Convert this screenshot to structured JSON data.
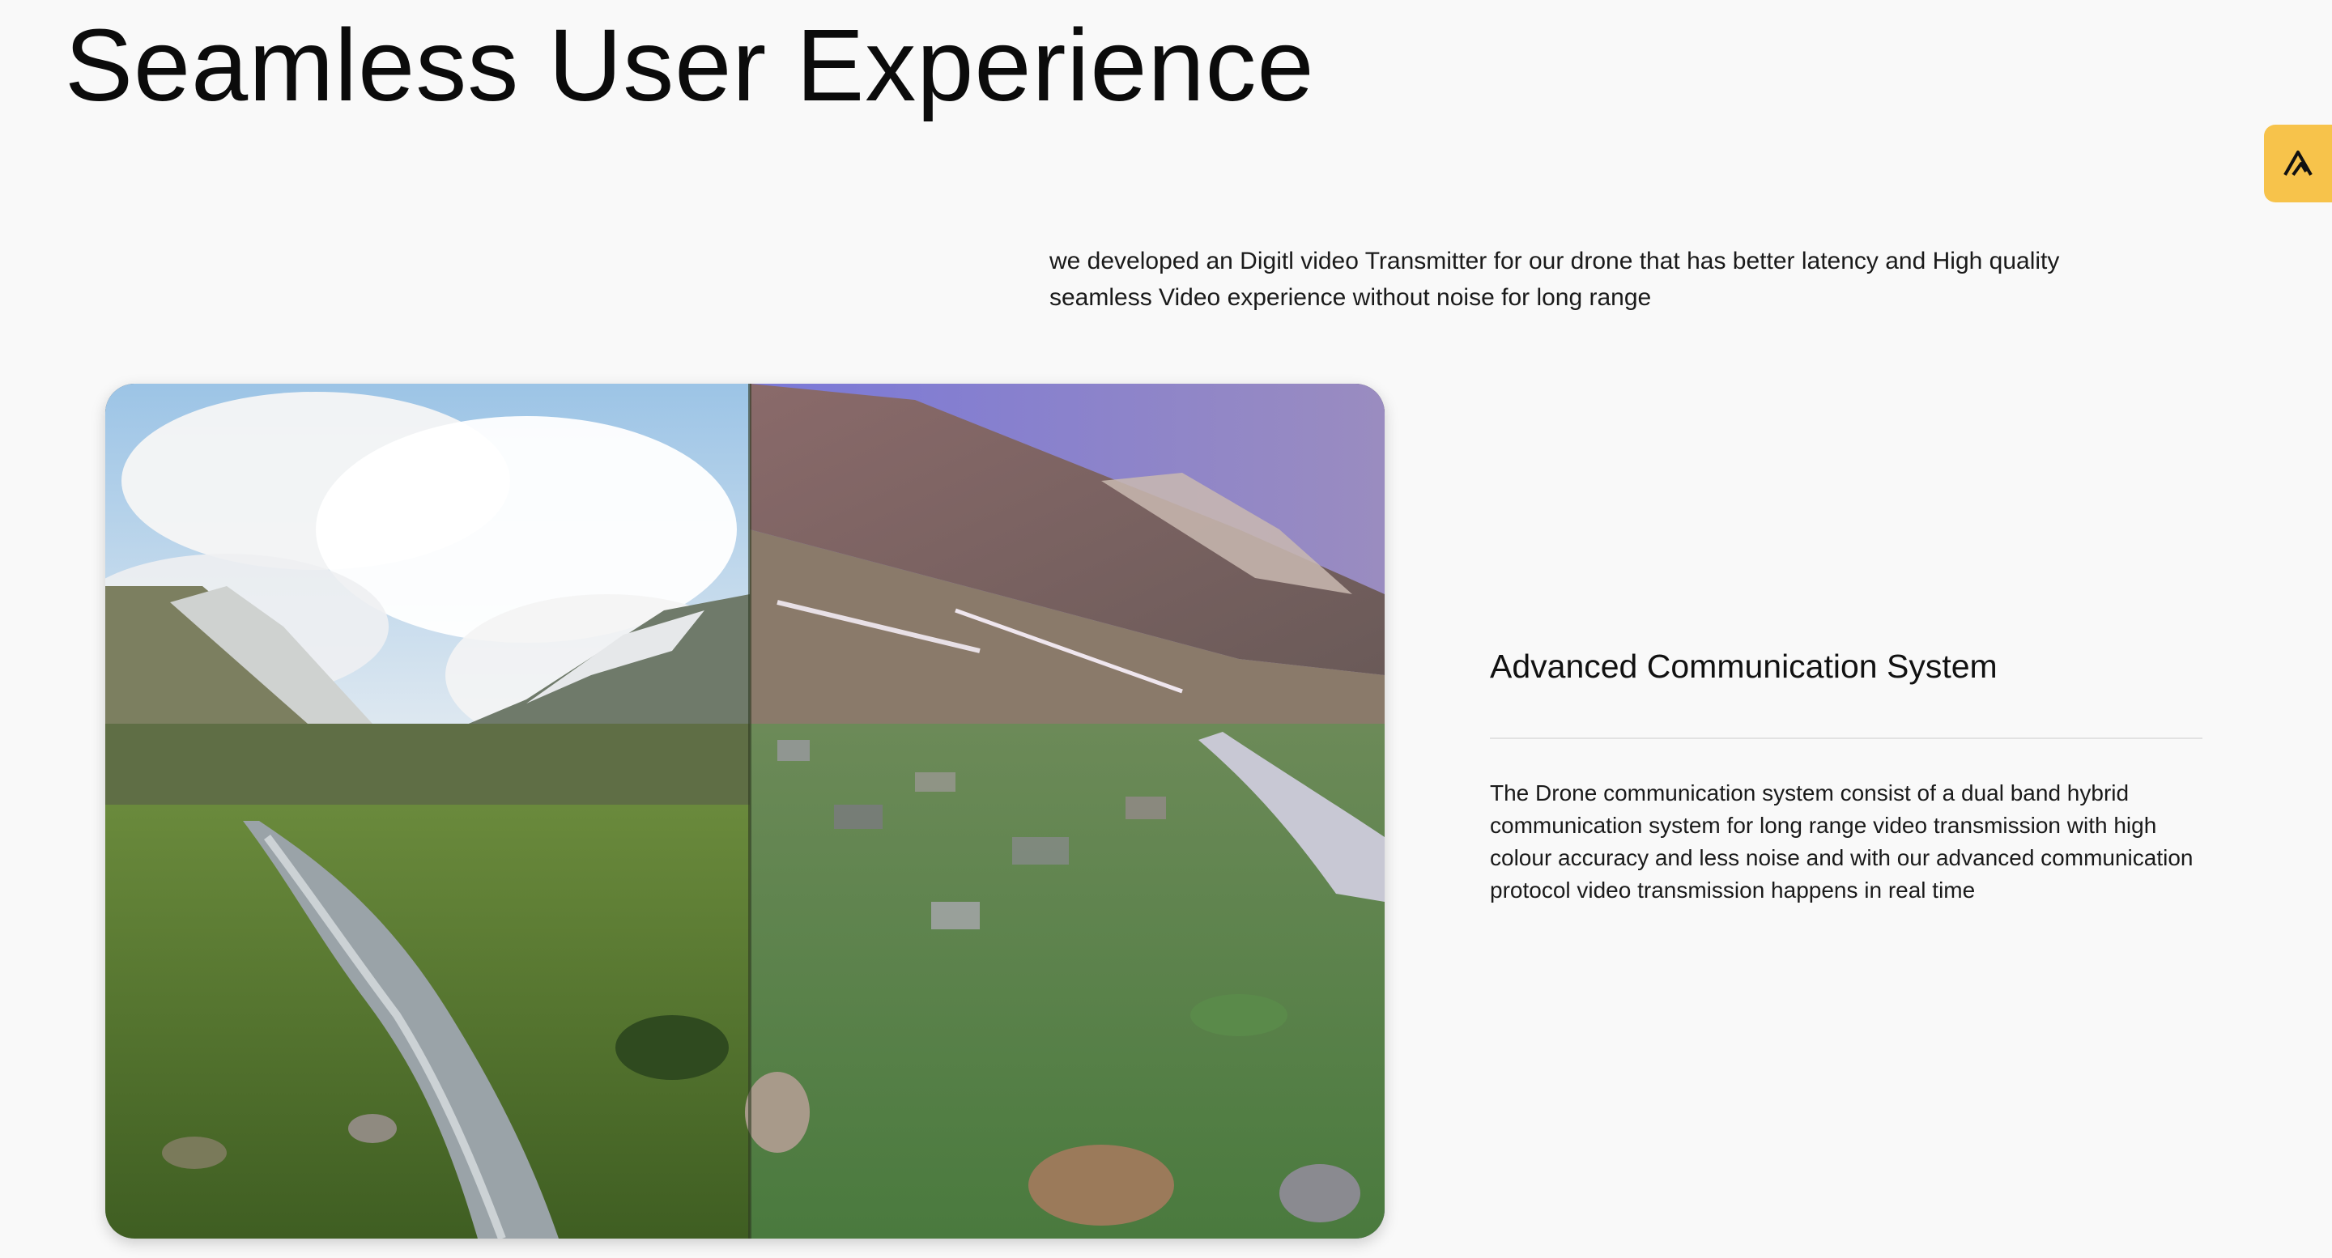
{
  "hero": {
    "title": "Seamless User Experience"
  },
  "intro": {
    "text": "we developed an Digitl video Transmitter for our drone that has better latency and High quality seamless Video experience without noise for long range"
  },
  "media": {
    "left_panel": "clean-digital-video-frame",
    "right_panel": "noisy-analog-video-frame"
  },
  "feature": {
    "title": "Advanced Communication System",
    "description": "The Drone communication system consist of a dual band hybrid communication system for long range video transmission with high colour accuracy and less noise and with our advanced communication protocol video transmission happens in real time"
  },
  "widget": {
    "icon": "brand-logo-icon",
    "color": "#f7c34b"
  }
}
